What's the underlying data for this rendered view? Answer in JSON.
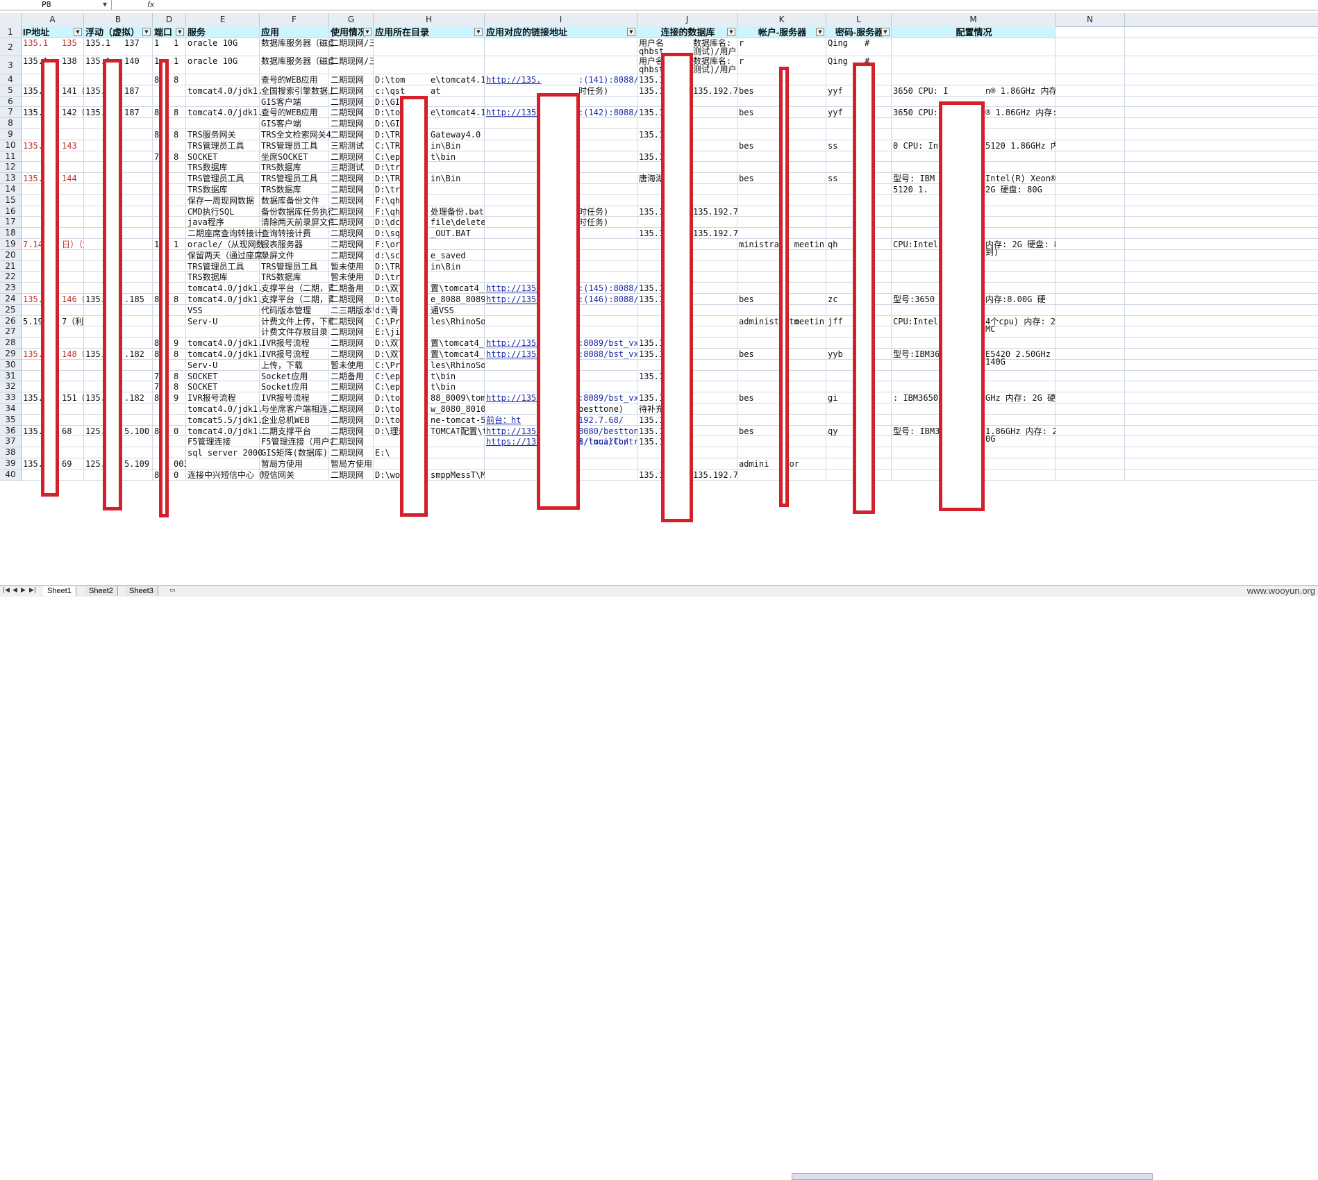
{
  "formula_bar": {
    "cell_ref": "P8",
    "fx_label": "fx"
  },
  "columns": [
    {
      "id": "A",
      "label": "A"
    },
    {
      "id": "B",
      "label": "B"
    },
    {
      "id": "D",
      "label": "D"
    },
    {
      "id": "E",
      "label": "E"
    },
    {
      "id": "F",
      "label": "F"
    },
    {
      "id": "G",
      "label": "G"
    },
    {
      "id": "H",
      "label": "H"
    },
    {
      "id": "I",
      "label": "I"
    },
    {
      "id": "J",
      "label": "J"
    },
    {
      "id": "K",
      "label": "K"
    },
    {
      "id": "L",
      "label": "L"
    },
    {
      "id": "M",
      "label": "M"
    },
    {
      "id": "N",
      "label": "N"
    }
  ],
  "rows": [
    "1",
    "2",
    "3",
    "4",
    "5",
    "6",
    "7",
    "8",
    "9",
    "10",
    "11",
    "12",
    "13",
    "14",
    "15",
    "16",
    "17",
    "18",
    "19",
    "20",
    "21",
    "22",
    "23",
    "24",
    "25",
    "26",
    "27",
    "28",
    "29",
    "30",
    "31",
    "32",
    "33",
    "34",
    "35",
    "36",
    "37",
    "38",
    "39",
    "40"
  ],
  "headers": {
    "A": "IP地址",
    "B": "浮动（虚拟）",
    "D": "端口",
    "E": "服务",
    "F": "应用",
    "G": "使用情况",
    "H": "应用所在目录",
    "I": "应用对应的链接地址",
    "J": "连接的数据库",
    "K": "帐户-服务器",
    "L": "密码-服务器",
    "M": "配置情况"
  },
  "cells": {
    "A": [
      [
        "2",
        "135.1",
        "135"
      ],
      [
        "3",
        "135.1",
        "138"
      ],
      [
        "5",
        "135.1",
        "141（负"
      ],
      [
        "7",
        "135.1",
        "142（负"
      ],
      [
        "10",
        "135.1",
        "143"
      ],
      [
        "13",
        "135.1",
        "144"
      ],
      [
        "19",
        "7.145",
        "日）（负"
      ],
      [
        "24",
        "135.1",
        "146（负"
      ],
      [
        "26",
        "5.192.",
        "7（利旧"
      ],
      [
        "29",
        "135.1",
        "148（负"
      ],
      [
        "33",
        "135.1",
        "151（负"
      ],
      [
        "36",
        "135.1",
        "68"
      ],
      [
        "39",
        "135.1",
        "69"
      ]
    ],
    "B": [
      [
        "2",
        "135.1",
        "137"
      ],
      [
        "3",
        "135.1",
        "140"
      ],
      [
        "5",
        "135.1",
        "187"
      ],
      [
        "7",
        "135.1",
        "187"
      ],
      [
        "24",
        "135.1",
        ".185"
      ],
      [
        "29",
        "135.1",
        ".182"
      ],
      [
        "33",
        "135.1",
        ".182"
      ],
      [
        "36",
        "125.7",
        "5.100"
      ],
      [
        "39",
        "125.7",
        "5.109"
      ]
    ],
    "D": [
      [
        "2",
        "1",
        "1"
      ],
      [
        "3",
        "1",
        "1"
      ],
      [
        "4",
        "8",
        "8"
      ],
      [
        "7",
        "8",
        "8"
      ],
      [
        "9",
        "8",
        "8"
      ],
      [
        "11",
        "7",
        "8"
      ],
      [
        "19",
        "1",
        "1"
      ],
      [
        "24",
        "8",
        "8"
      ],
      [
        "28",
        "8",
        "9"
      ],
      [
        "29",
        "8",
        "8"
      ],
      [
        "31",
        "7",
        "8"
      ],
      [
        "32",
        "7",
        "8"
      ],
      [
        "33",
        "8",
        "9"
      ],
      [
        "36",
        "8",
        "0"
      ],
      [
        "39",
        "",
        "003"
      ],
      [
        "40",
        "8",
        "0"
      ]
    ],
    "E": [
      [
        "2",
        "oracle 10G"
      ],
      [
        "3",
        "oracle 10G"
      ],
      [
        "5",
        "tomcat4.0/jdk1.4"
      ],
      [
        "7",
        "tomcat4.0/jdk1.4"
      ],
      [
        "9",
        "TRS服务网关"
      ],
      [
        "10",
        "TRS管理员工具"
      ],
      [
        "11",
        "SOCKET"
      ],
      [
        "12",
        "TRS数据库"
      ],
      [
        "13",
        "TRS管理员工具"
      ],
      [
        "14",
        "TRS数据库"
      ],
      [
        "15",
        "保存一周现网数据"
      ],
      [
        "16",
        "CMD执行SQL"
      ],
      [
        "17",
        "java程序"
      ],
      [
        "18",
        "二期座席查询转接计费"
      ],
      [
        "19",
        "oracle/（从现网数据库"
      ],
      [
        "20",
        "保留两天（通过座席客"
      ],
      [
        "21",
        "TRS管理员工具"
      ],
      [
        "22",
        "TRS数据库"
      ],
      [
        "23",
        "tomcat4.0/jdk1.4"
      ],
      [
        "24",
        "tomcat4.0/jdk1.4"
      ],
      [
        "25",
        "VSS"
      ],
      [
        "26",
        "Serv-U"
      ],
      [
        "28",
        "tomcat4.0/jdk1.4"
      ],
      [
        "29",
        "tomcat4.0/jdk1.4"
      ],
      [
        "30",
        "Serv-U"
      ],
      [
        "31",
        "SOCKET"
      ],
      [
        "32",
        "SOCKET"
      ],
      [
        "33",
        "IVR报号流程"
      ],
      [
        "34",
        "tomcat4.0/jdk1.4"
      ],
      [
        "35",
        "tomcat5.5/jdk1.5"
      ],
      [
        "36",
        "tomcat4.0/jdk1.5/"
      ],
      [
        "37",
        "F5管理连接"
      ],
      [
        "38",
        "sql server 2000(二"
      ],
      [
        "40",
        "连接中兴短信中心（"
      ]
    ],
    "F": [
      [
        "2",
        "数据库服务器（磁盘"
      ],
      [
        "3",
        "数据库服务器（磁盘"
      ],
      [
        "4",
        "查号的WEB应用"
      ],
      [
        "5",
        "全国搜索引擎数据上"
      ],
      [
        "6",
        "GIS客户端"
      ],
      [
        "7",
        "查号的WEB应用"
      ],
      [
        "8",
        "GIS客户端"
      ],
      [
        "9",
        "TRS全文检索网关4.0"
      ],
      [
        "10",
        "TRS管理员工具"
      ],
      [
        "11",
        "坐席SOCKET"
      ],
      [
        "12",
        "TRS数据库"
      ],
      [
        "13",
        "TRS管理员工具"
      ],
      [
        "14",
        "TRS数据库"
      ],
      [
        "15",
        "数据库备份文件"
      ],
      [
        "16",
        "备份数据库任务执行"
      ],
      [
        "17",
        "清除两天前录屏文件"
      ],
      [
        "18",
        "查询转接计费"
      ],
      [
        "19",
        "报表服务器"
      ],
      [
        "20",
        "录屏文件"
      ],
      [
        "21",
        "TRS管理员工具"
      ],
      [
        "22",
        "TRS数据库"
      ],
      [
        "23",
        "支撑平台（二期，青"
      ],
      [
        "24",
        "支撑平台（二期，青"
      ],
      [
        "25",
        "代码版本管理"
      ],
      [
        "26",
        "计费文件上传，下载"
      ],
      [
        "27",
        "计费文件存放目录"
      ],
      [
        "28",
        "IVR报号流程"
      ],
      [
        "29",
        "IVR报号流程"
      ],
      [
        "30",
        "上传，下载"
      ],
      [
        "31",
        "Socket应用"
      ],
      [
        "32",
        "Socket应用"
      ],
      [
        "33",
        "IVR报号流程"
      ],
      [
        "34",
        "与坐席客户端相连，"
      ],
      [
        "35",
        "企业总机WEB"
      ],
      [
        "36",
        "二期支撑平台"
      ],
      [
        "37",
        "F5管理连接（用户名"
      ],
      [
        "38",
        "GIS矩阵(数据库)"
      ],
      [
        "39",
        "暂局方使用"
      ],
      [
        "40",
        "短信网关"
      ]
    ],
    "G": [
      [
        "2",
        "二期现网/三期测试"
      ],
      [
        "3",
        "二期现网/三期测试"
      ],
      [
        "4",
        "二期现网"
      ],
      [
        "5",
        "二期现网"
      ],
      [
        "6",
        "二期现网"
      ],
      [
        "7",
        "二期现网"
      ],
      [
        "8",
        "二期现网"
      ],
      [
        "9",
        "二期现网"
      ],
      [
        "10",
        "三期测试"
      ],
      [
        "11",
        "二期现网"
      ],
      [
        "12",
        "三期测试"
      ],
      [
        "13",
        "二期现网"
      ],
      [
        "14",
        "二期现网"
      ],
      [
        "15",
        "二期现网"
      ],
      [
        "16",
        "二期现网"
      ],
      [
        "17",
        "二期现网"
      ],
      [
        "18",
        "二期现网"
      ],
      [
        "19",
        "二期现网"
      ],
      [
        "20",
        "二期现网"
      ],
      [
        "21",
        "暂未使用"
      ],
      [
        "22",
        "暂未使用"
      ],
      [
        "23",
        "二期备用"
      ],
      [
        "24",
        "二期现网"
      ],
      [
        "25",
        "二三期版本管"
      ],
      [
        "26",
        "二期现网"
      ],
      [
        "27",
        "二期现网"
      ],
      [
        "28",
        "二期现网"
      ],
      [
        "29",
        "二期现网"
      ],
      [
        "30",
        "暂未使用"
      ],
      [
        "31",
        "二期备用"
      ],
      [
        "32",
        "二期现网"
      ],
      [
        "33",
        "二期现网"
      ],
      [
        "34",
        "二期现网"
      ],
      [
        "35",
        "二期现网"
      ],
      [
        "36",
        "二期现网"
      ],
      [
        "37",
        "二期现网"
      ],
      [
        "38",
        "二期现网"
      ],
      [
        "39",
        "暂局方使用"
      ],
      [
        "40",
        "二期现网"
      ]
    ],
    "H": [
      [
        "4",
        "D:\\tom",
        "e\\tomcat4.1.24"
      ],
      [
        "5",
        "c:\\qst",
        "at"
      ],
      [
        "6",
        "D:\\GIS",
        ""
      ],
      [
        "7",
        "D:\\tom",
        "e\\tomcat4.1.24"
      ],
      [
        "8",
        "D:\\GIS",
        ""
      ],
      [
        "9",
        "D:\\TRS",
        "Gateway4.0"
      ],
      [
        "10",
        "C:\\TRS",
        "in\\Bin"
      ],
      [
        "11",
        "C:\\epa",
        "t\\bin"
      ],
      [
        "12",
        "D:\\trs",
        ""
      ],
      [
        "13",
        "D:\\TRS",
        "in\\Bin"
      ],
      [
        "14",
        "D:\\trs",
        ""
      ],
      [
        "15",
        "F:\\qhb",
        ""
      ],
      [
        "16",
        "F:\\qhb",
        "处理备份.bat"
      ],
      [
        "17",
        "D:\\dc",
        "file\\deleteStart.bat"
      ],
      [
        "18",
        "D:\\sql",
        "_OUT.BAT"
      ],
      [
        "19",
        "F:\\orc",
        ""
      ],
      [
        "20",
        "d:\\scr",
        "e_saved"
      ],
      [
        "21",
        "D:\\TRS",
        "in\\Bin"
      ],
      [
        "22",
        "D:\\trs",
        ""
      ],
      [
        "23",
        "D:\\双T",
        "置\\tomcat4_one_"
      ],
      [
        "24",
        "D:\\tom",
        "e_8088_8089\\to"
      ],
      [
        "25",
        "d:\\青",
        "通VSS"
      ],
      [
        "26",
        "C:\\Pro",
        "les\\RhinoSoft.com\\Serv-U"
      ],
      [
        "27",
        "E:\\jif",
        ""
      ],
      [
        "28",
        "D:\\双T",
        "置\\tomcat4_8089"
      ],
      [
        "29",
        "D:\\双T",
        "置\\tomcat4_tow_"
      ],
      [
        "30",
        "C:\\Pro",
        "les\\RhinoSoft.com\\Serv-U"
      ],
      [
        "31",
        "C:\\epa",
        "t\\bin"
      ],
      [
        "32",
        "C:\\epa",
        "t\\bin"
      ],
      [
        "33",
        "D:\\tom",
        "88_8009\\tomcat"
      ],
      [
        "34",
        "D:\\tom",
        "w_8080_8010\\tomcat4.1.24\\bi"
      ],
      [
        "35",
        "D:\\too",
        "ne-tomcat-5.5."
      ],
      [
        "36",
        "D:\\理想",
        "TOMCAT配置\\tom"
      ],
      [
        "38",
        "E:\\",
        ""
      ],
      [
        "40",
        "D:\\wor",
        "smppMessT\\MessSmpp.bat"
      ]
    ],
    "I": [
      [
        "4",
        "http://135.",
        ":(141):8088/be"
      ],
      [
        "5",
        "",
        "时任务)"
      ],
      [
        "7",
        "http://135.",
        ":(142):8088/be"
      ],
      [
        "16",
        "",
        "时任务)"
      ],
      [
        "17",
        "",
        "时任务)"
      ],
      [
        "23",
        "http://135.",
        ":(145):8088/be"
      ],
      [
        "24",
        "http://135.",
        ":(146):8088/be"
      ],
      [
        "28",
        "http://135.",
        ":8089/bst_vxm"
      ],
      [
        "29",
        "http://135.",
        ":8088/bst_vxm"
      ],
      [
        "33",
        "http://135.",
        ":8089/bst_vxm"
      ],
      [
        "34",
        "",
        "besttone)"
      ],
      [
        "35",
        "前台：ht",
        "192.7.68/"
      ],
      [
        "36",
        "http://135.",
        "8080/besttone"
      ],
      [
        "37",
        "https://135",
        "8/tmui/Control/jsp",
        "i/locallb/"
      ]
    ],
    "J": [
      [
        "2",
        "用户名",
        "数据库名:"
      ],
      [
        "2b",
        "qhbst",
        "测试)/用户"
      ],
      [
        "3",
        "用户名",
        "数据库名:"
      ],
      [
        "3b",
        "qhbst",
        "测试)/用户"
      ],
      [
        "4",
        "135.1",
        ""
      ],
      [
        "5",
        "135.1",
        "135.192.7."
      ],
      [
        "7",
        "135.1",
        ""
      ],
      [
        "9",
        "135.1",
        ""
      ],
      [
        "11",
        "135.1",
        ""
      ],
      [
        "13",
        "唐海湖",
        ""
      ],
      [
        "16",
        "135.1",
        "135.192.7."
      ],
      [
        "18",
        "135.1",
        "135.192.7."
      ],
      [
        "23",
        "135.1",
        ""
      ],
      [
        "24",
        "135.1",
        ""
      ],
      [
        "28",
        "135.1",
        ""
      ],
      [
        "29",
        "135.1",
        ""
      ],
      [
        "31",
        "135.1",
        ""
      ],
      [
        "33",
        "135.1",
        ""
      ],
      [
        "34",
        "待补充",
        ""
      ],
      [
        "35",
        "135.1",
        ""
      ],
      [
        "36",
        "135.1",
        ""
      ],
      [
        "37",
        "135.1",
        ""
      ],
      [
        "40",
        "135.1",
        "135.192.7."
      ]
    ],
    "K": [
      [
        "2",
        "r",
        ""
      ],
      [
        "3",
        "r",
        ""
      ],
      [
        "5",
        "bes",
        "ne"
      ],
      [
        "7",
        "bes",
        "ne"
      ],
      [
        "10",
        "bes",
        "ne"
      ],
      [
        "13",
        "bes",
        "ne"
      ],
      [
        "19",
        "ministrato",
        "et meetin"
      ],
      [
        "24",
        "bes",
        "ne"
      ],
      [
        "26",
        "administrato",
        "et meetin"
      ],
      [
        "29",
        "bes",
        "ne"
      ],
      [
        "33",
        "bes",
        "ne"
      ],
      [
        "36",
        "bes",
        "ne"
      ],
      [
        "39",
        "admini",
        "ator"
      ]
    ],
    "L": [
      [
        "2",
        "Qing",
        "#"
      ],
      [
        "3",
        "Qing",
        "#"
      ],
      [
        "5",
        "yyf",
        ""
      ],
      [
        "7",
        "yyf",
        ""
      ],
      [
        "10",
        "ss",
        ""
      ],
      [
        "13",
        "ss",
        ""
      ],
      [
        "19",
        "qh",
        ""
      ],
      [
        "24",
        "zc",
        ""
      ],
      [
        "26",
        "jff",
        ""
      ],
      [
        "29",
        "yyb",
        ""
      ],
      [
        "33",
        "gi",
        ""
      ],
      [
        "36",
        "qy",
        ""
      ]
    ],
    "M": [
      [
        "5",
        "3650  CPU: I",
        "n® 1.86GHz 内存: 2"
      ],
      [
        "7",
        "3650  CPU: I",
        "® 1.86GHz  内存: 2"
      ],
      [
        "10",
        "0  CPU: Inte",
        "5120 1.86GHz  内存"
      ],
      [
        "13",
        "型号: IBM",
        "Intel(R) Xeon®"
      ],
      [
        "14",
        "5120 1.",
        "2G 硬盘: 80G"
      ],
      [
        "19",
        "CPU:Intel x",
        "内存: 2G 硬盘: 80G"
      ],
      [
        "19b",
        "",
        "到)"
      ],
      [
        "24",
        "型号:3650",
        "内存:8.00G 硬"
      ],
      [
        "26",
        "CPU:Intel",
        "4个cpu) 内存: 2G"
      ],
      [
        "26b",
        "",
        "MC"
      ],
      [
        "29",
        "型号:IBM3650",
        "E5420 2.50GHz  内"
      ],
      [
        "29b",
        "",
        "140G"
      ],
      [
        "33",
        ": IBM3650 C",
        "GHz 内存: 2G 硬盘:"
      ],
      [
        "36",
        "型号: IBM36",
        "1.86GHz 内存: 2G"
      ],
      [
        "36b",
        "",
        "0G"
      ]
    ]
  },
  "sheets": [
    "Sheet1",
    "Sheet2",
    "Sheet3"
  ],
  "watermark": "www.wooyun.org",
  "colors": {
    "header_fill": "#ccf5ff",
    "redaction": "#d4202a",
    "red_text": "#c0302a",
    "link": "#1a2aa8"
  }
}
